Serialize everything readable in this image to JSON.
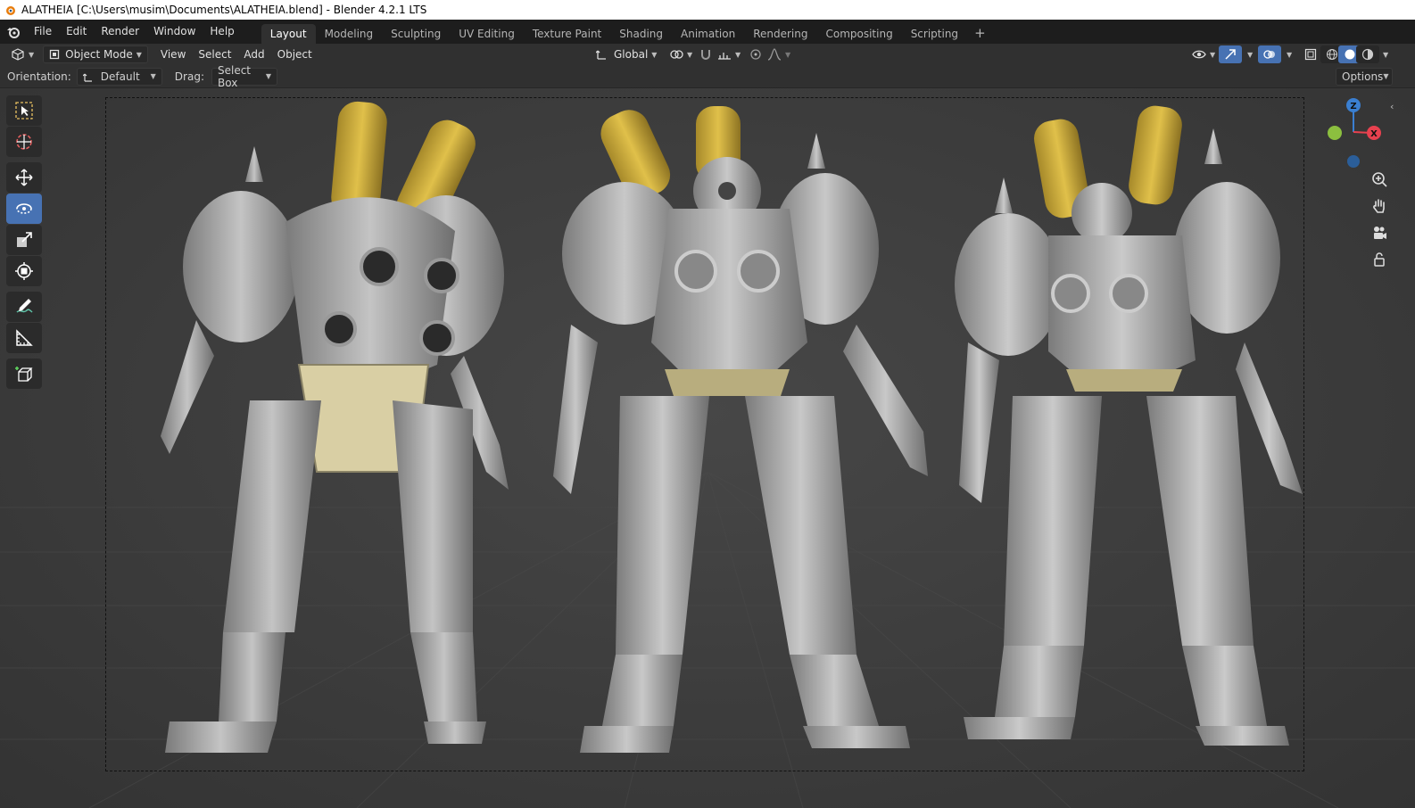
{
  "window": {
    "title": "ALATHEIA [C:\\Users\\musim\\Documents\\ALATHEIA.blend] - Blender 4.2.1 LTS"
  },
  "menu": {
    "items": [
      "File",
      "Edit",
      "Render",
      "Window",
      "Help"
    ]
  },
  "workspaces": {
    "tabs": [
      "Layout",
      "Modeling",
      "Sculpting",
      "UV Editing",
      "Texture Paint",
      "Shading",
      "Animation",
      "Rendering",
      "Compositing",
      "Scripting"
    ],
    "active": "Layout",
    "add_label": "+"
  },
  "header": {
    "mode": "Object Mode",
    "view": "View",
    "select": "Select",
    "add": "Add",
    "object": "Object",
    "transform_orientation": "Global"
  },
  "tool_settings": {
    "orientation_label": "Orientation:",
    "orientation_value": "Default",
    "drag_label": "Drag:",
    "drag_value": "Select Box",
    "options_label": "Options"
  },
  "toolbar": {
    "tools": [
      "select-box",
      "cursor",
      "move",
      "rotate",
      "scale",
      "transform",
      "annotate",
      "measure",
      "add-cube"
    ],
    "active": "rotate"
  },
  "gizmo": {
    "z_label": "Z",
    "x_label": "X"
  },
  "colors": {
    "accent": "#4772b3",
    "axis_x": "#e8414f",
    "axis_y": "#8cbf3f",
    "axis_z": "#3a7fd1",
    "yellow_parts": "#c9a93a",
    "cream_part": "#d9cfa4",
    "metal": "#a8a8a8"
  }
}
